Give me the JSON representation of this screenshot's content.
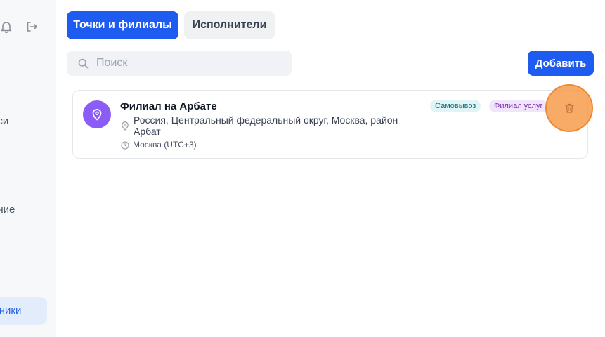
{
  "sidebar": {
    "items": [
      {
        "label": "иси",
        "icon": "document-icon"
      },
      {
        "label": "ание",
        "icon": "calendar-icon"
      }
    ],
    "active_item": {
      "label": "дники"
    },
    "top_icons": [
      "bell-icon",
      "logout-icon"
    ]
  },
  "tabs": [
    {
      "label": "Точки и филиалы",
      "active": true
    },
    {
      "label": "Исполнители",
      "active": false
    }
  ],
  "search": {
    "placeholder": "Поиск",
    "value": ""
  },
  "add_button": {
    "label": "Добавить"
  },
  "branches": [
    {
      "title": "Филиал на Арбате",
      "address": "Россия, Центральный федеральный округ, Москва, район Арбат",
      "timezone": "Москва (UTC+3)",
      "badges": [
        "Самовывоз",
        "Филиал услуг"
      ]
    }
  ],
  "colors": {
    "accent": "#1e5bf0",
    "avatar": "#8b5cf6",
    "highlight": "#f69846"
  }
}
